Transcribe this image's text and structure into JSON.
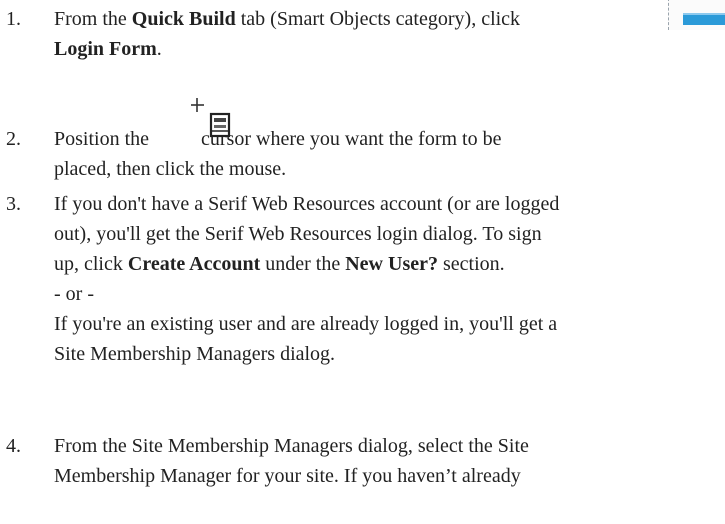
{
  "steps": [
    {
      "num": "1.",
      "l1_a": "From the ",
      "l1_b": "Quick Build",
      "l1_c": " tab (Smart Objects category), click",
      "l2": "Login Form",
      "l2_after": ".",
      "icon": "login-form-icon"
    },
    {
      "num": "2.",
      "l1_a": "Position the",
      "l1_b": "cursor where you want the form to be",
      "l2": "placed, then click the mouse.",
      "icon": "form-insert-cursor-icon"
    },
    {
      "num": "3.",
      "l1": "If you don't have a Serif Web Resources account (or are logged",
      "l2": "out), you'll get the Serif Web Resources login dialog. To sign",
      "l3_a": "up, click ",
      "l3_b": "Create Account",
      "l3_c": " under the ",
      "l3_d": "New User?",
      "l3_e": " section.",
      "l4": "- or -",
      "l5": "If you're an existing user and are already logged in, you'll get a",
      "l6": "Site Membership Managers dialog."
    },
    {
      "num": "4.",
      "l1": "From the Site Membership Managers dialog, select the Site",
      "l2": "Membership Manager for your site. If you haven’t already"
    }
  ]
}
